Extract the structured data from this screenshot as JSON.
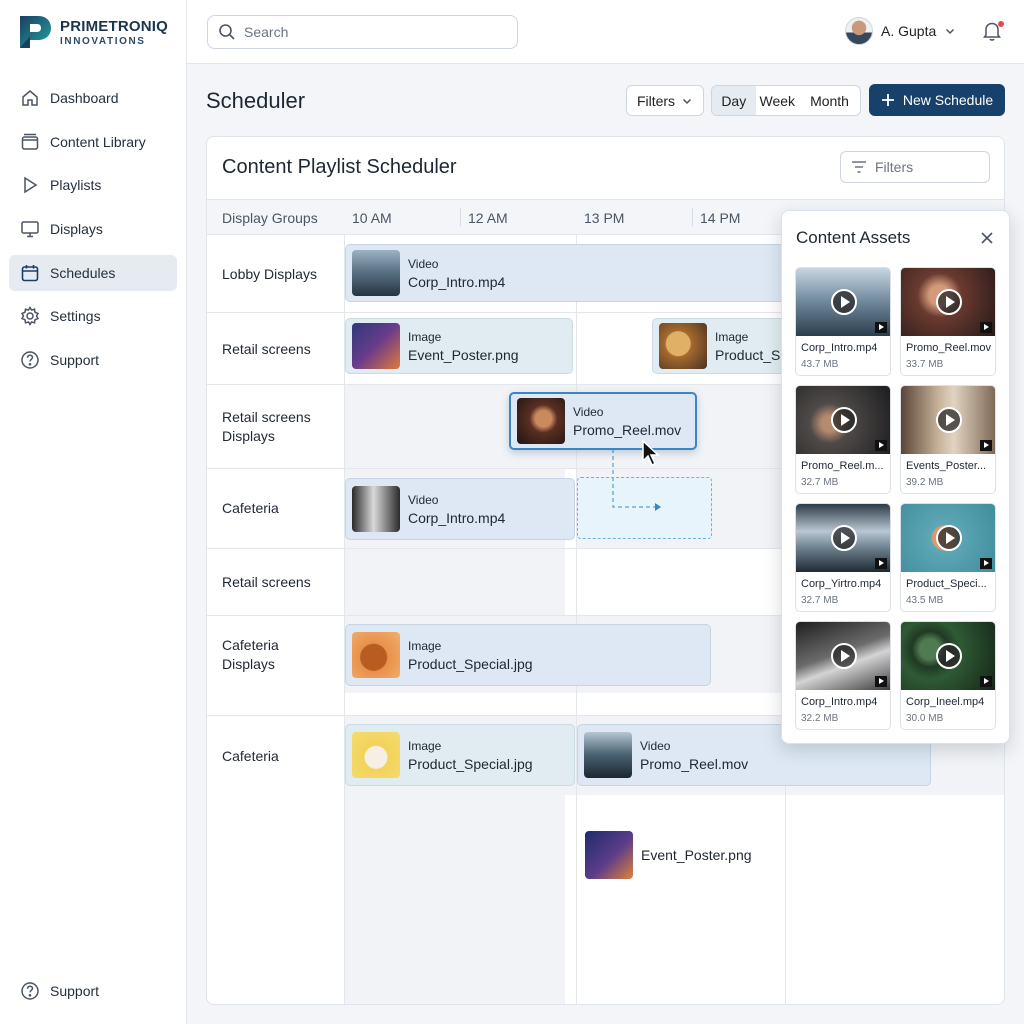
{
  "brand": {
    "name": "PRIMETRONIQ",
    "sub": "INNOVATIONS"
  },
  "sidebar": {
    "items": [
      {
        "label": "Dashboard",
        "icon": "home-icon"
      },
      {
        "label": "Content Library",
        "icon": "folder-icon"
      },
      {
        "label": "Playlists",
        "icon": "play-icon"
      },
      {
        "label": "Displays",
        "icon": "monitor-icon"
      },
      {
        "label": "Schedules",
        "icon": "calendar-icon",
        "active": true
      },
      {
        "label": "Settings",
        "icon": "gear-icon"
      },
      {
        "label": "Support",
        "icon": "help-icon"
      }
    ],
    "bottom": {
      "label": "Support",
      "icon": "help-icon"
    }
  },
  "topbar": {
    "search_placeholder": "Search",
    "user_name": "A. Gupta"
  },
  "header": {
    "title": "Scheduler",
    "filters_label": "Filters",
    "views": [
      "Day",
      "Week",
      "Month"
    ],
    "active_view": "Day",
    "new_button": "New Schedule"
  },
  "scheduler": {
    "title": "Content Playlist Scheduler",
    "filter_placeholder": "Filters",
    "columns": [
      "Display Groups",
      "10 AM",
      "12 AM",
      "13 PM",
      "14 PM"
    ],
    "rows": [
      "Lobby Displays",
      "Retail screens",
      "Retail screens Displays",
      "Cafeteria",
      "Retail screens",
      "Cafeteria Displays",
      "Cafeteria"
    ],
    "events": [
      {
        "type": "Video",
        "file": "Corp_Intro.mp4"
      },
      {
        "type": "Image",
        "file": "Event_Poster.png"
      },
      {
        "type": "Image",
        "file": "Product_Sp"
      },
      {
        "type": "Video",
        "file": "Promo_Reel.mov"
      },
      {
        "type": "Video",
        "file": "Corp_Intro.mp4"
      },
      {
        "type": "Image",
        "file": "Product_Special.jpg"
      },
      {
        "type": "Image",
        "file": "Product_Special.jpg"
      },
      {
        "type": "Video",
        "file": "Promo_Reel.mov"
      },
      {
        "type": "",
        "file": "Event_Poster.png"
      }
    ]
  },
  "assets_panel": {
    "title": "Content Assets",
    "items": [
      {
        "name": "Corp_Intro.mp4",
        "size": "43.7 MB"
      },
      {
        "name": "Promo_Reel.mov",
        "size": "33.7 MB"
      },
      {
        "name": "Promo_Reel.m...",
        "size": "32.7 MB"
      },
      {
        "name": "Events_Poster...",
        "size": "39.2 MB"
      },
      {
        "name": "Corp_Yirtro.mp4",
        "size": "32.7 MB"
      },
      {
        "name": "Product_Speci...",
        "size": "43.5 MB"
      },
      {
        "name": "Corp_Intro.mp4",
        "size": "32.2 MB"
      },
      {
        "name": "Corp_Ineel.mp4",
        "size": "30.0 MB"
      }
    ]
  },
  "colors": {
    "primary": "#17416b",
    "accent": "#3a86c4",
    "notification": "#e24a4a"
  }
}
